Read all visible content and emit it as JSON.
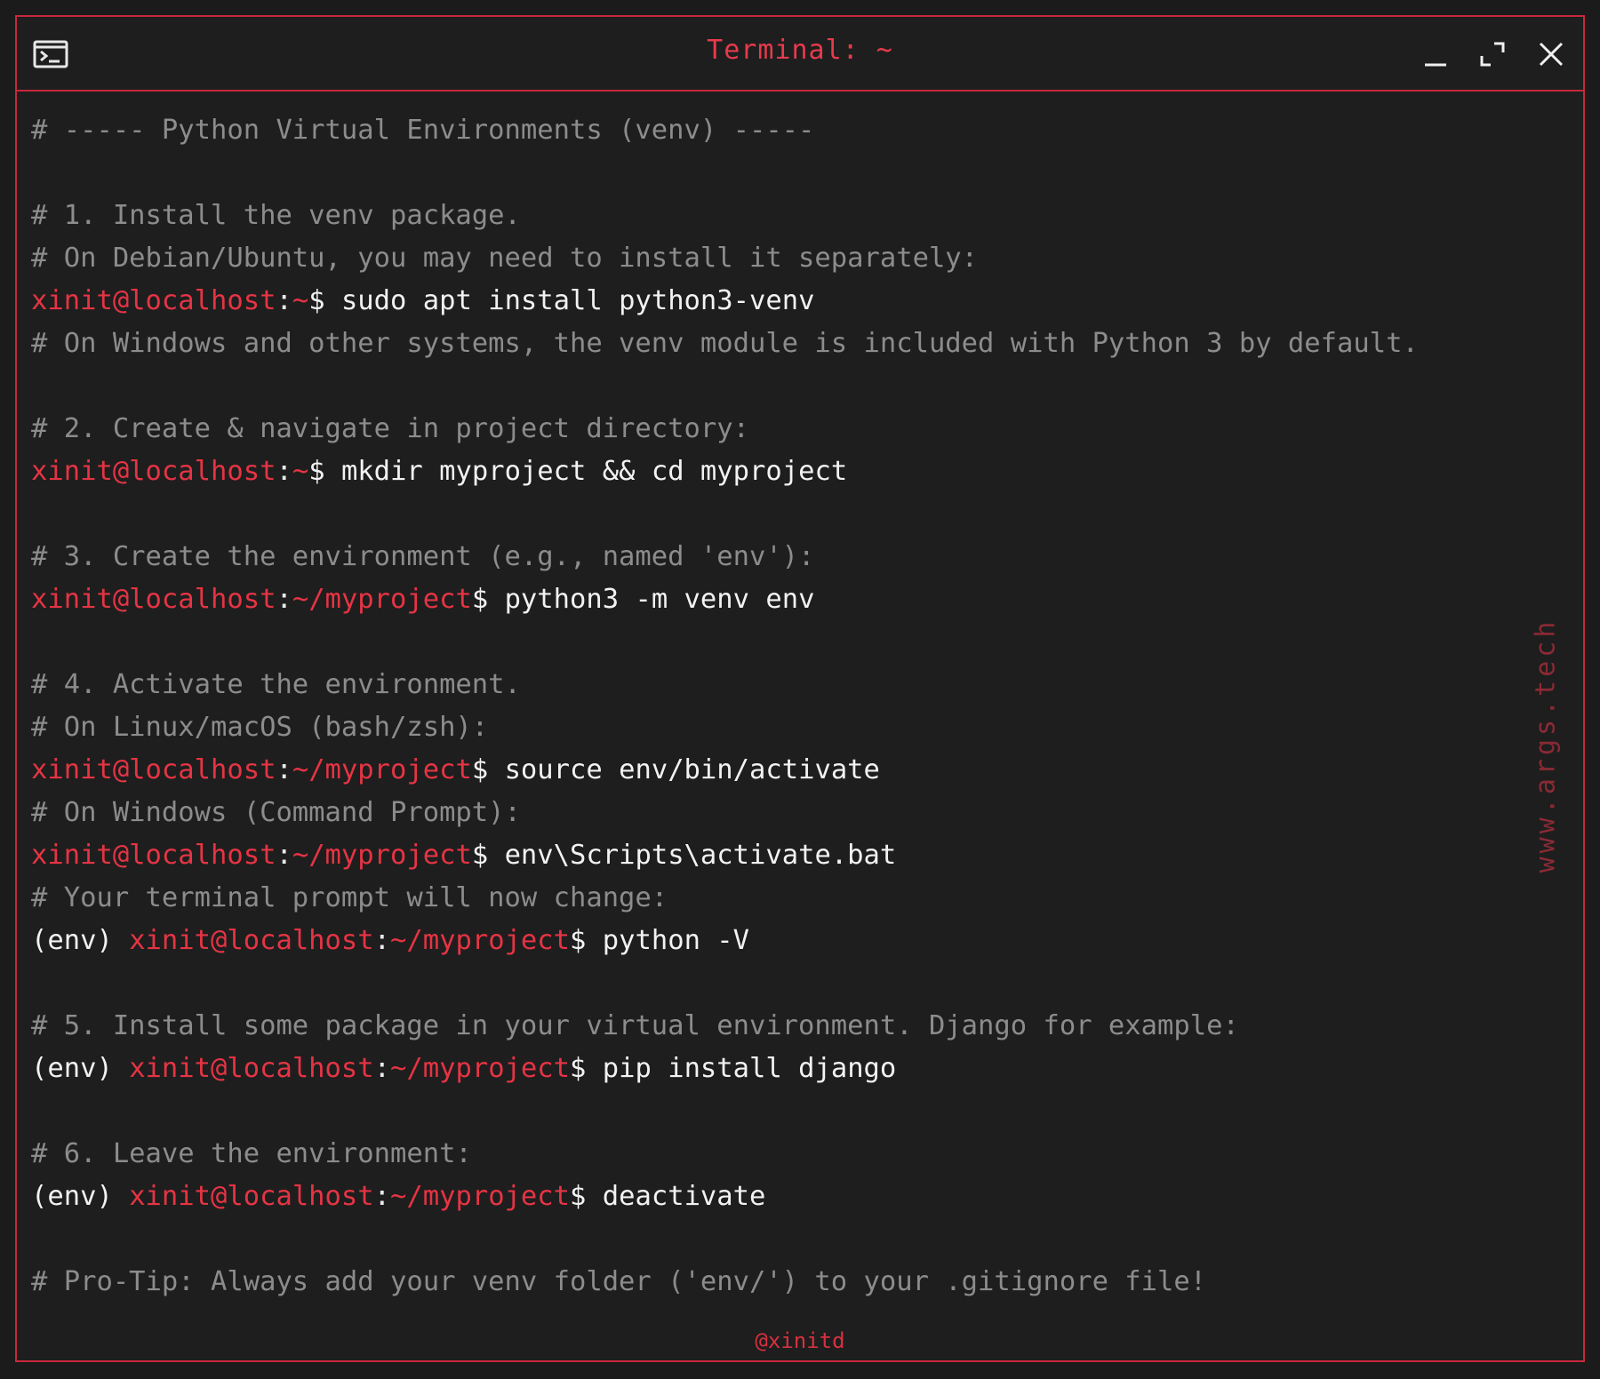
{
  "window": {
    "title": "Terminal: ~",
    "accent_color": "#c8283c",
    "icons": {
      "app": "terminal-icon",
      "minimize": "minimize-icon",
      "maximize": "maximize-icon",
      "close": "close-icon"
    }
  },
  "terminal": {
    "lines": [
      {
        "type": "comment",
        "text": "# ----- Python Virtual Environments (venv) -----"
      },
      {
        "type": "blank"
      },
      {
        "type": "comment",
        "text": "# 1. Install the venv package."
      },
      {
        "type": "comment",
        "text": "# On Debian/Ubuntu, you may need to install it separately:"
      },
      {
        "type": "prompt",
        "env": "",
        "user": "xinit@localhost",
        "path": "~",
        "cmd": " sudo apt install python3-venv"
      },
      {
        "type": "comment",
        "text": "# On Windows and other systems, the venv module is included with Python 3 by default."
      },
      {
        "type": "blank"
      },
      {
        "type": "comment",
        "text": "# 2. Create & navigate in project directory:"
      },
      {
        "type": "prompt",
        "env": "",
        "user": "xinit@localhost",
        "path": "~",
        "cmd": " mkdir myproject && cd myproject"
      },
      {
        "type": "blank"
      },
      {
        "type": "comment",
        "text": "# 3. Create the environment (e.g., named 'env'):"
      },
      {
        "type": "prompt",
        "env": "",
        "user": "xinit@localhost",
        "path": "~/myproject",
        "cmd": " python3 -m venv env"
      },
      {
        "type": "blank"
      },
      {
        "type": "comment",
        "text": "# 4. Activate the environment."
      },
      {
        "type": "comment",
        "text": "# On Linux/macOS (bash/zsh):"
      },
      {
        "type": "prompt",
        "env": "",
        "user": "xinit@localhost",
        "path": "~/myproject",
        "cmd": " source env/bin/activate"
      },
      {
        "type": "comment",
        "text": "# On Windows (Command Prompt):"
      },
      {
        "type": "prompt",
        "env": "",
        "user": "xinit@localhost",
        "path": "~/myproject",
        "cmd": " env\\Scripts\\activate.bat"
      },
      {
        "type": "comment",
        "text": "# Your terminal prompt will now change:"
      },
      {
        "type": "prompt",
        "env": "(env) ",
        "user": "xinit@localhost",
        "path": "~/myproject",
        "cmd": " python -V"
      },
      {
        "type": "blank"
      },
      {
        "type": "comment",
        "text": "# 5. Install some package in your virtual environment. Django for example:"
      },
      {
        "type": "prompt",
        "env": "(env) ",
        "user": "xinit@localhost",
        "path": "~/myproject",
        "cmd": " pip install django"
      },
      {
        "type": "blank"
      },
      {
        "type": "comment",
        "text": "# 6. Leave the environment:"
      },
      {
        "type": "prompt",
        "env": "(env) ",
        "user": "xinit@localhost",
        "path": "~/myproject",
        "cmd": " deactivate"
      },
      {
        "type": "blank"
      },
      {
        "type": "comment",
        "text": "# Pro-Tip: Always add your venv folder ('env/') to your .gitignore file!"
      }
    ]
  },
  "watermark": "www.args.tech",
  "handle": "@xinitd"
}
